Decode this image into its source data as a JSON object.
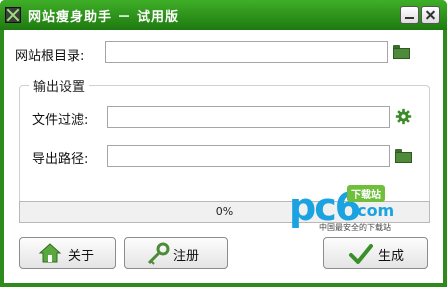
{
  "window": {
    "title": "网站瘦身助手 － 试用版",
    "minimize_icon": "minimize-icon",
    "close_icon": "close-icon",
    "accent": "#2f8a1c"
  },
  "form": {
    "root_label": "网站根目录:",
    "root_value": "",
    "group_title": "输出设置",
    "filter_label": "文件过滤:",
    "filter_value": "",
    "export_label": "导出路径:",
    "export_value": ""
  },
  "progress": {
    "value": 0,
    "text": "0%"
  },
  "buttons": {
    "about": "关于",
    "register": "注册",
    "generate": "生成"
  },
  "watermark": {
    "brand": "pc6",
    "badge": "下载站",
    "domain": ".com",
    "tagline": "中国最安全的下载站"
  }
}
